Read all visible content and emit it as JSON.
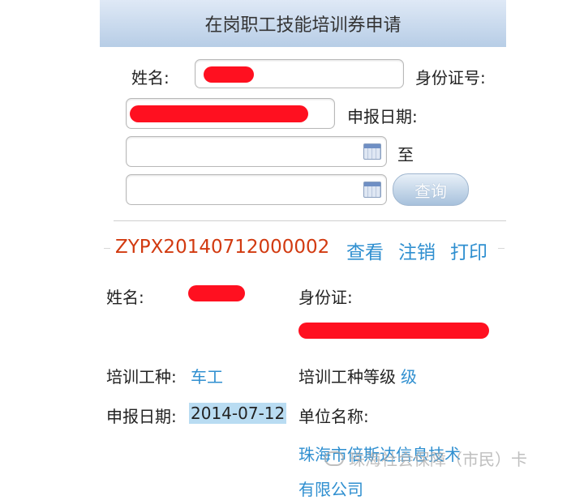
{
  "header": {
    "title": "在岗职工技能培训券申请"
  },
  "search": {
    "name_label": "姓名:",
    "id_label": "身份证号:",
    "date_label": "申报日期:",
    "to_label": "至",
    "query_label": "查询"
  },
  "record": {
    "number": "ZYPX20140712000002",
    "actions": {
      "view": "查看",
      "cancel": "注销",
      "print": "打印"
    },
    "name_label": "姓名:",
    "id_label": "身份证:",
    "trade_label": "培训工种:",
    "trade_value": "车工",
    "level_label": "培训工种等级",
    "level_value": "级",
    "date_label": "申报日期:",
    "date_value": "2014-07-12",
    "unit_label": "单位名称:",
    "unit_value_line1": "珠海市倍斯达信息技术",
    "unit_value_line2": "有限公司"
  },
  "watermark": {
    "text": "珠海社会保障（市民）卡"
  },
  "colors": {
    "accent": "#2f8fd0",
    "order": "#d23a10",
    "redaction": "#ff1020"
  }
}
